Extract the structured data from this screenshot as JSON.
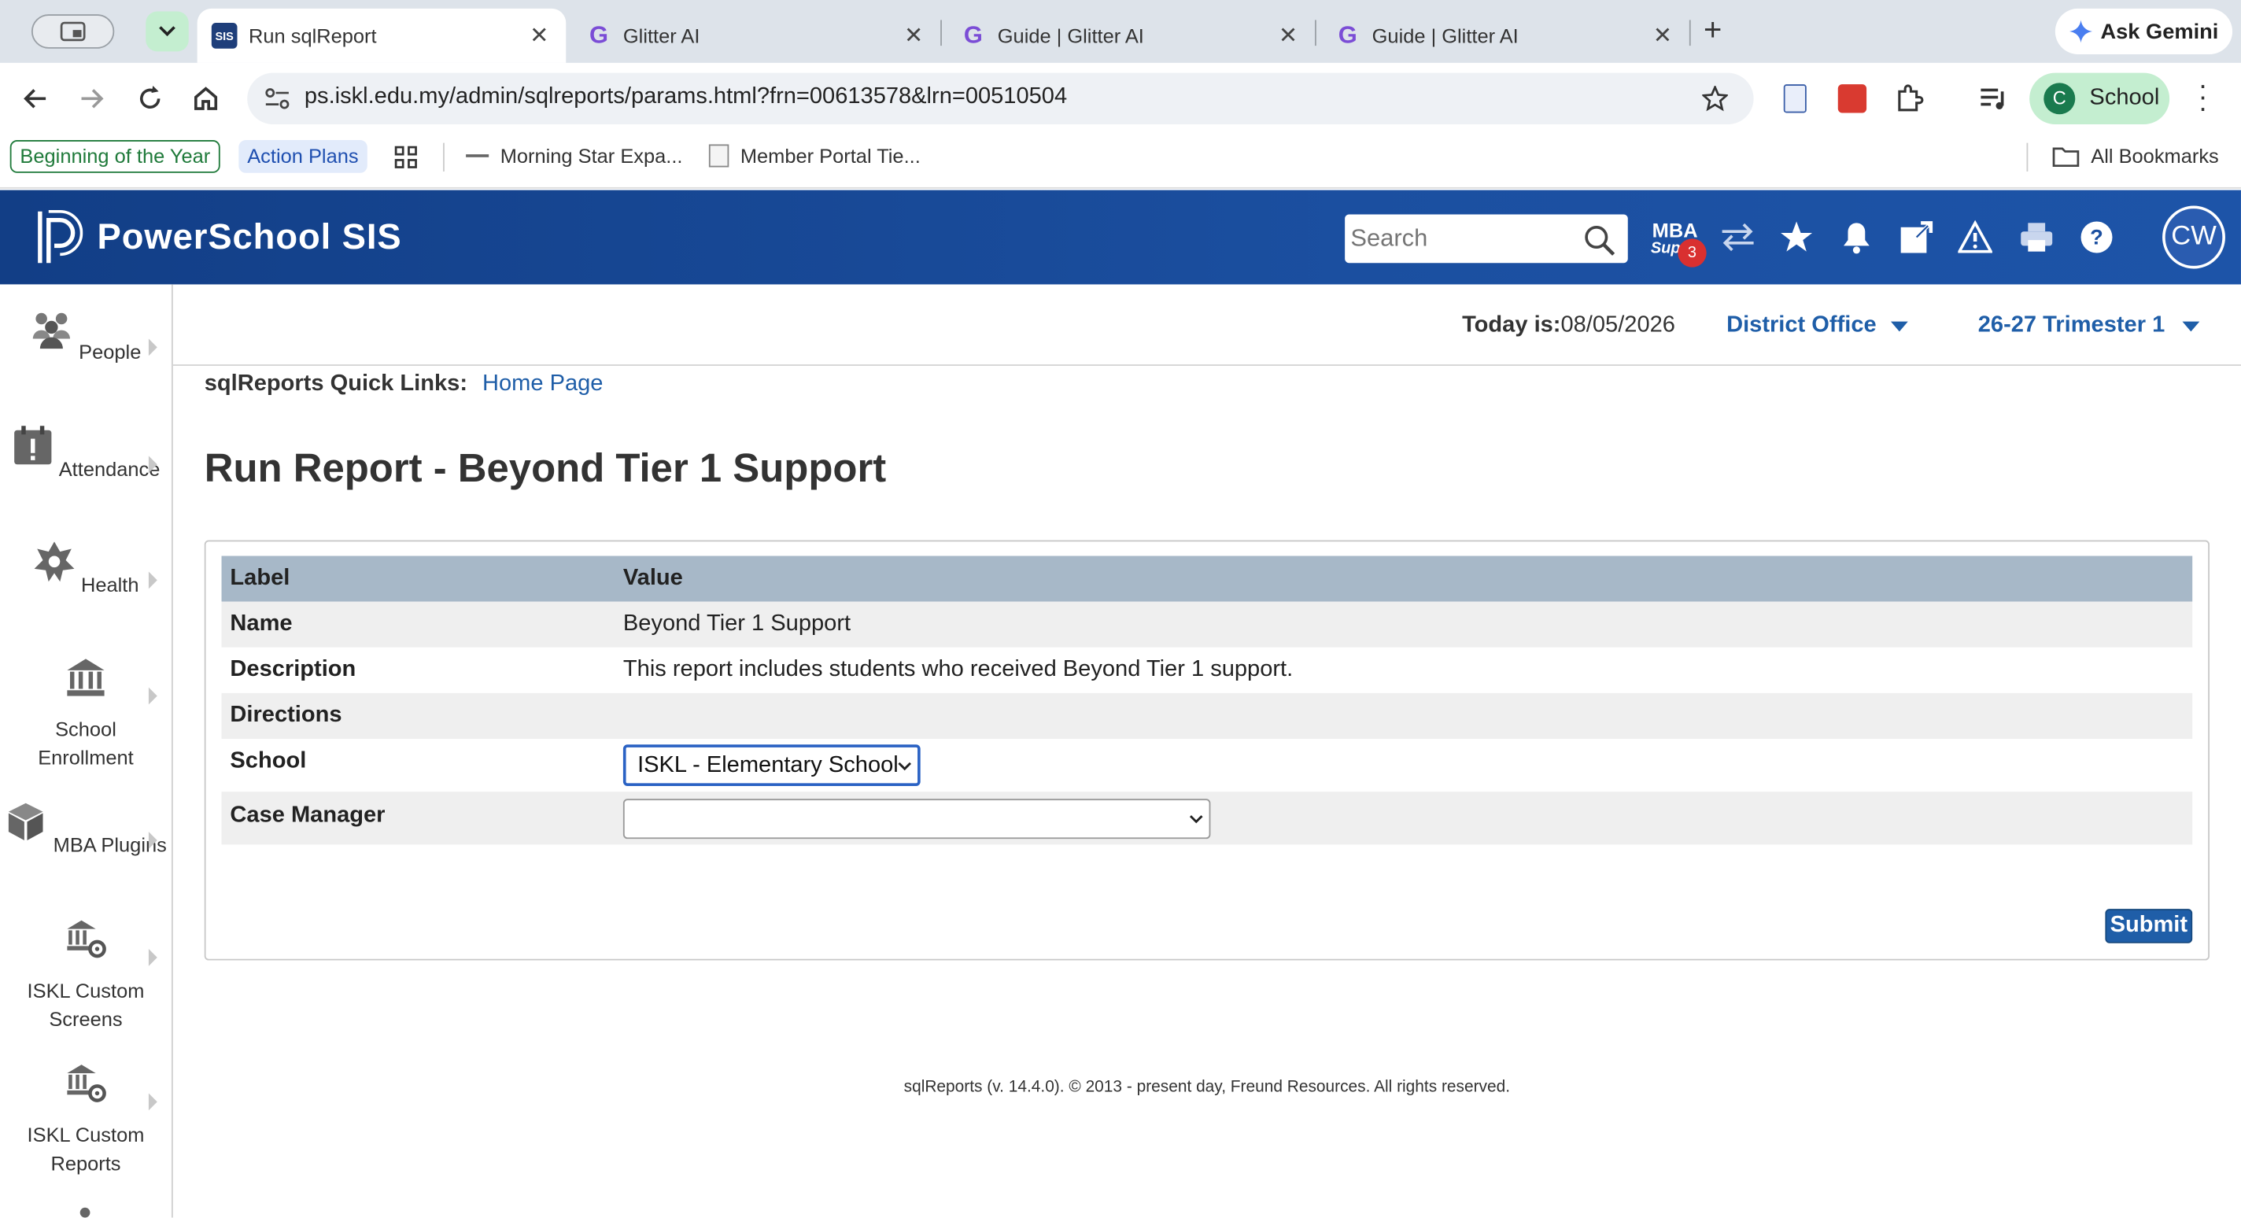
{
  "browser": {
    "tabs": [
      {
        "label": "Run sqlReport",
        "favicon": "SIS"
      },
      {
        "label": "Glitter AI"
      },
      {
        "label": "Guide | Glitter AI"
      },
      {
        "label": "Guide | Glitter AI"
      }
    ],
    "ask_gemini": "Ask Gemini",
    "url": "ps.iskl.edu.my/admin/sqlreports/params.html?frn=00613578&lrn=00510504",
    "profile_initial": "C",
    "profile_label": "School",
    "bookmarks": [
      {
        "label": "Beginning of the Year"
      },
      {
        "label": "Action Plans"
      },
      {
        "label": "Morning Star Expa..."
      },
      {
        "label": "Member Portal Tie..."
      }
    ],
    "all_bookmarks": "All Bookmarks"
  },
  "header": {
    "brand": "PowerSchool SIS",
    "search_placeholder": "Search",
    "mba_top": "MBA",
    "mba_bottom": "Supp",
    "mba_badge": "3",
    "avatar": "CW"
  },
  "sidebar": {
    "items": [
      {
        "label": "People",
        "icon": "people-icon"
      },
      {
        "label": "Attendance",
        "icon": "attendance-icon"
      },
      {
        "label": "Health",
        "icon": "health-icon"
      },
      {
        "label": "School Enrollment",
        "icon": "school-icon"
      },
      {
        "label": "MBA Plugins",
        "icon": "plugin-icon"
      },
      {
        "label": "ISKL Custom Screens",
        "icon": "school-gear-icon"
      },
      {
        "label": "ISKL Custom Reports",
        "icon": "school-gear-icon"
      }
    ]
  },
  "topbar": {
    "today_label": "Today is:",
    "today_value": "08/05/2026",
    "school": "District Office",
    "term": "26-27 Trimester 1"
  },
  "quicklinks": {
    "label": "sqlReports Quick Links:",
    "home": "Home Page"
  },
  "page_title": "Run Report - Beyond Tier 1 Support",
  "table": {
    "header_label": "Label",
    "header_value": "Value",
    "rows": [
      {
        "label": "Name",
        "value": "Beyond Tier 1 Support"
      },
      {
        "label": "Description",
        "value": "This report includes students who received Beyond Tier 1 support."
      },
      {
        "label": "Directions",
        "value": ""
      },
      {
        "label": "School",
        "value": "ISKL - Elementary School"
      },
      {
        "label": "Case Manager",
        "value": ""
      }
    ]
  },
  "submit_label": "Submit",
  "footer": "sqlReports (v. 14.4.0). © 2013 - present day, Freund Resources. All rights reserved.",
  "colors": {
    "header_blue": "#1b4fa0",
    "link_blue": "#1f5ea8",
    "table_header": "#a7b8c8",
    "submit": "#1f5ea8"
  }
}
